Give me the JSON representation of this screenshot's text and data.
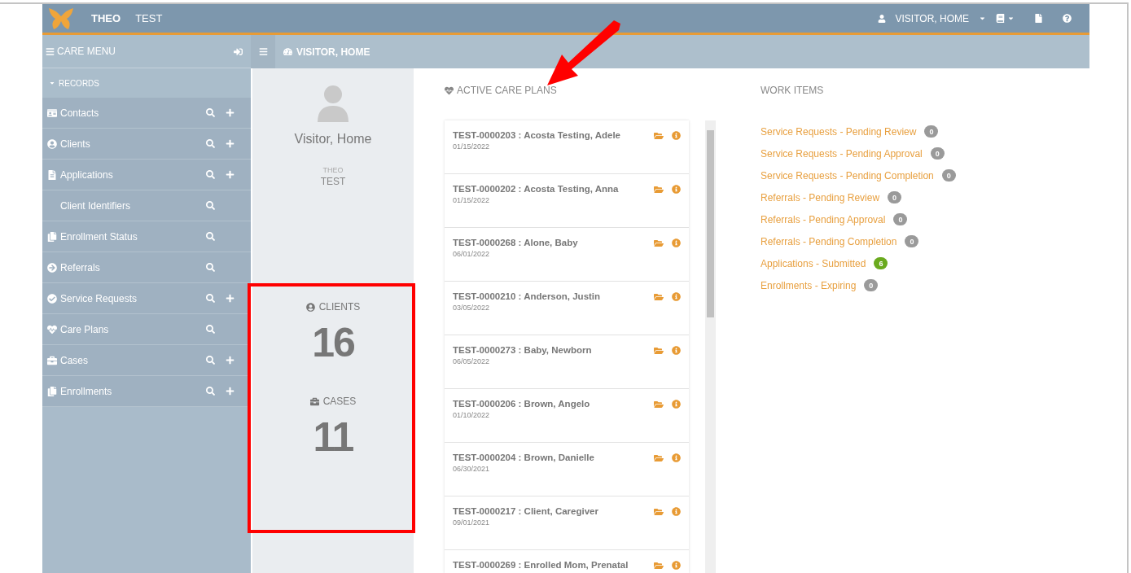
{
  "topbar": {
    "brand": "THEO",
    "org": "TEST",
    "user": "VISITOR, HOME"
  },
  "sidebar": {
    "title": "CARE MENU",
    "section": {
      "label": "RECORDS",
      "expanded": true
    },
    "items": [
      {
        "label": "Contacts",
        "search": true,
        "add": true
      },
      {
        "label": "Clients",
        "search": true,
        "add": true
      },
      {
        "label": "Applications",
        "search": true,
        "add": true,
        "children": [
          {
            "label": "Client Identifiers",
            "search": true,
            "add": false
          }
        ]
      },
      {
        "label": "Enrollment Status",
        "search": true,
        "add": false
      },
      {
        "label": "Referrals",
        "search": true,
        "add": false
      },
      {
        "label": "Service Requests",
        "search": true,
        "add": true
      },
      {
        "label": "Care Plans",
        "search": true,
        "add": false
      },
      {
        "label": "Cases",
        "search": true,
        "add": true
      },
      {
        "label": "Enrollments",
        "search": true,
        "add": true
      }
    ]
  },
  "breadcrumb": "VISITOR, HOME",
  "profile": {
    "name": "Visitor, Home",
    "org_label": "THEO",
    "org": "TEST",
    "stats": [
      {
        "label": "CLIENTS",
        "value": "16"
      },
      {
        "label": "CASES",
        "value": "11"
      }
    ]
  },
  "care_plans": {
    "title": "ACTIVE CARE PLANS",
    "rows": [
      {
        "title": "TEST-0000203 : Acosta Testing, Adele",
        "date": "01/15/2022"
      },
      {
        "title": "TEST-0000202 : Acosta Testing, Anna",
        "date": "01/15/2022"
      },
      {
        "title": "TEST-0000268 : Alone, Baby",
        "date": "06/01/2022"
      },
      {
        "title": "TEST-0000210 : Anderson, Justin",
        "date": "03/05/2022"
      },
      {
        "title": "TEST-0000273 : Baby, Newborn",
        "date": "06/05/2022"
      },
      {
        "title": "TEST-0000206 : Brown, Angelo",
        "date": "01/10/2022"
      },
      {
        "title": "TEST-0000204 : Brown, Danielle",
        "date": "06/30/2021"
      },
      {
        "title": "TEST-0000217 : Client, Caregiver",
        "date": "09/01/2021"
      },
      {
        "title": "TEST-0000269 : Enrolled Mom, Prenatal"
      }
    ]
  },
  "work_items": {
    "title": "WORK ITEMS",
    "items": [
      {
        "label": "Service Requests - Pending Review",
        "count": "0",
        "color": "#9a9a9a"
      },
      {
        "label": "Service Requests - Pending Approval",
        "count": "0",
        "color": "#9a9a9a"
      },
      {
        "label": "Service Requests - Pending Completion",
        "count": "0",
        "color": "#9a9a9a"
      },
      {
        "label": "Referrals - Pending Review",
        "count": "0",
        "color": "#9a9a9a"
      },
      {
        "label": "Referrals - Pending Approval",
        "count": "0",
        "color": "#9a9a9a"
      },
      {
        "label": "Referrals - Pending Completion",
        "count": "0",
        "color": "#9a9a9a"
      },
      {
        "label": "Applications - Submitted",
        "count": "6",
        "color": "#6aaa1e"
      },
      {
        "label": "Enrollments - Expiring",
        "count": "0",
        "color": "#9a9a9a"
      }
    ]
  }
}
